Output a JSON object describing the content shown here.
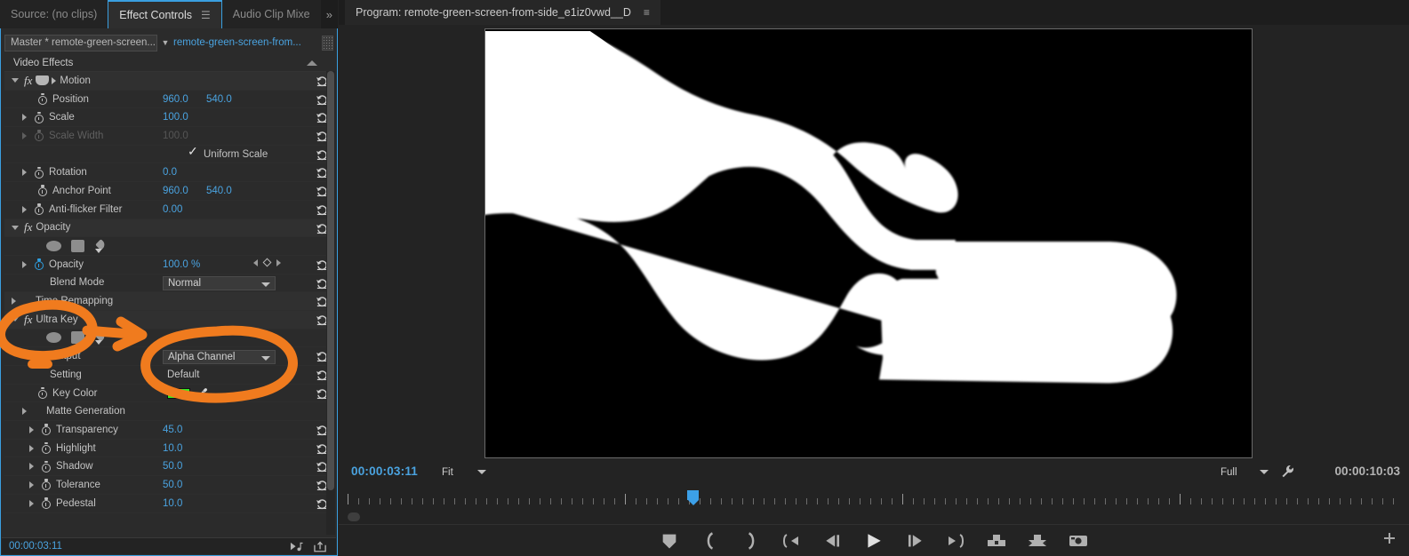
{
  "panels": {
    "left": {
      "tabs": [
        {
          "label": "Source: (no clips)",
          "active": false,
          "has_menu": false
        },
        {
          "label": "Effect Controls",
          "active": true,
          "has_menu": true
        },
        {
          "label": "Audio Clip Mixe",
          "active": false,
          "has_menu": false
        }
      ],
      "overflow_glyph": "»",
      "clip_header": {
        "master_label": "Master * remote-green-screen...",
        "sequence_clip": "remote-green-screen-from..."
      },
      "section_title": "Video Effects",
      "footer": {
        "timecode": "00:00:03:11"
      },
      "effects": [
        {
          "name": "Motion",
          "type": "effect-header",
          "icon": "motion-icon",
          "properties": [
            {
              "label": "Position",
              "values": [
                "960.0",
                "540.0"
              ],
              "disclosure": false,
              "stopwatch": true,
              "kind": "numeric"
            },
            {
              "label": "Scale",
              "values": [
                "100.0"
              ],
              "disclosure": true,
              "stopwatch": true,
              "kind": "numeric"
            },
            {
              "label": "Scale Width",
              "values": [
                "100.0"
              ],
              "disclosure": true,
              "stopwatch": true,
              "kind": "numeric",
              "disabled": true
            },
            {
              "label": "Uniform Scale",
              "values": [],
              "disclosure": false,
              "stopwatch": false,
              "kind": "checkbox",
              "checked": true
            },
            {
              "label": "Rotation",
              "values": [
                "0.0"
              ],
              "disclosure": true,
              "stopwatch": true,
              "kind": "numeric"
            },
            {
              "label": "Anchor Point",
              "values": [
                "960.0",
                "540.0"
              ],
              "disclosure": false,
              "stopwatch": true,
              "kind": "numeric"
            },
            {
              "label": "Anti-flicker Filter",
              "values": [
                "0.00"
              ],
              "disclosure": true,
              "stopwatch": true,
              "kind": "numeric"
            }
          ]
        },
        {
          "name": "Opacity",
          "type": "effect-header",
          "icon": "fx-icon",
          "properties": [
            {
              "label": "",
              "values": [],
              "kind": "mask-tools"
            },
            {
              "label": "Opacity",
              "values": [
                "100.0 %"
              ],
              "disclosure": true,
              "stopwatch": true,
              "stopwatch_on": true,
              "kind": "numeric",
              "keyframe_nav": true
            },
            {
              "label": "Blend Mode",
              "values": [
                "Normal"
              ],
              "disclosure": false,
              "stopwatch": false,
              "kind": "dropdown"
            }
          ]
        },
        {
          "name": "Time Remapping",
          "type": "effect-header",
          "icon": "none",
          "properties": []
        },
        {
          "name": "Ultra Key",
          "type": "effect-header",
          "icon": "fx-icon",
          "properties": [
            {
              "label": "",
              "values": [],
              "kind": "mask-tools"
            },
            {
              "label": "Output",
              "values": [
                "Alpha Channel"
              ],
              "disclosure": false,
              "stopwatch": false,
              "kind": "dropdown"
            },
            {
              "label": "Setting",
              "values": [
                "Default"
              ],
              "disclosure": false,
              "stopwatch": false,
              "kind": "plain"
            },
            {
              "label": "Key Color",
              "values": [],
              "disclosure": false,
              "stopwatch": true,
              "kind": "color",
              "color": "#33EE22"
            },
            {
              "label": "Matte Generation",
              "values": [],
              "disclosure": true,
              "stopwatch": false,
              "kind": "group"
            },
            {
              "label": "Transparency",
              "values": [
                "45.0"
              ],
              "disclosure": true,
              "stopwatch": true,
              "kind": "numeric",
              "indent": 2
            },
            {
              "label": "Highlight",
              "values": [
                "10.0"
              ],
              "disclosure": true,
              "stopwatch": true,
              "kind": "numeric",
              "indent": 2
            },
            {
              "label": "Shadow",
              "values": [
                "50.0"
              ],
              "disclosure": true,
              "stopwatch": true,
              "kind": "numeric",
              "indent": 2
            },
            {
              "label": "Tolerance",
              "values": [
                "50.0"
              ],
              "disclosure": true,
              "stopwatch": true,
              "kind": "numeric",
              "indent": 2
            },
            {
              "label": "Pedestal",
              "values": [
                "10.0"
              ],
              "disclosure": true,
              "stopwatch": true,
              "kind": "numeric",
              "indent": 2
            }
          ]
        }
      ]
    },
    "program": {
      "tab_label": "Program: remote-green-screen-from-side_e1iz0vwd__D",
      "menu_glyph": "≡",
      "current_timecode": "00:00:03:11",
      "duration_timecode": "00:00:10:03",
      "fit_label": "Fit",
      "quality_label": "Full",
      "playhead_percent": 32.8,
      "transport_buttons": [
        "add-marker-button",
        "mark-in-button",
        "mark-out-button",
        "go-to-in-button",
        "step-back-button",
        "play-stop-button",
        "step-forward-button",
        "go-to-out-button",
        "lift-button",
        "extract-button",
        "export-frame-button"
      ],
      "preview": {
        "description": "Ultra Key alpha channel matte: white hand silhouette over keyboard on black background"
      }
    }
  },
  "annotations": {
    "color": "#F07B1E",
    "shapes": [
      {
        "name": "ultra-key-circle",
        "kind": "ellipse"
      },
      {
        "name": "arrow-to-output",
        "kind": "arrow"
      },
      {
        "name": "output-underline",
        "kind": "dash"
      },
      {
        "name": "alpha-channel-circle",
        "kind": "ellipse"
      }
    ]
  },
  "colors": {
    "accent_blue": "#4aa3e0",
    "panel_bg": "#2b2b2b",
    "annotation_orange": "#F07B1E",
    "key_color_green": "#33EE22"
  }
}
